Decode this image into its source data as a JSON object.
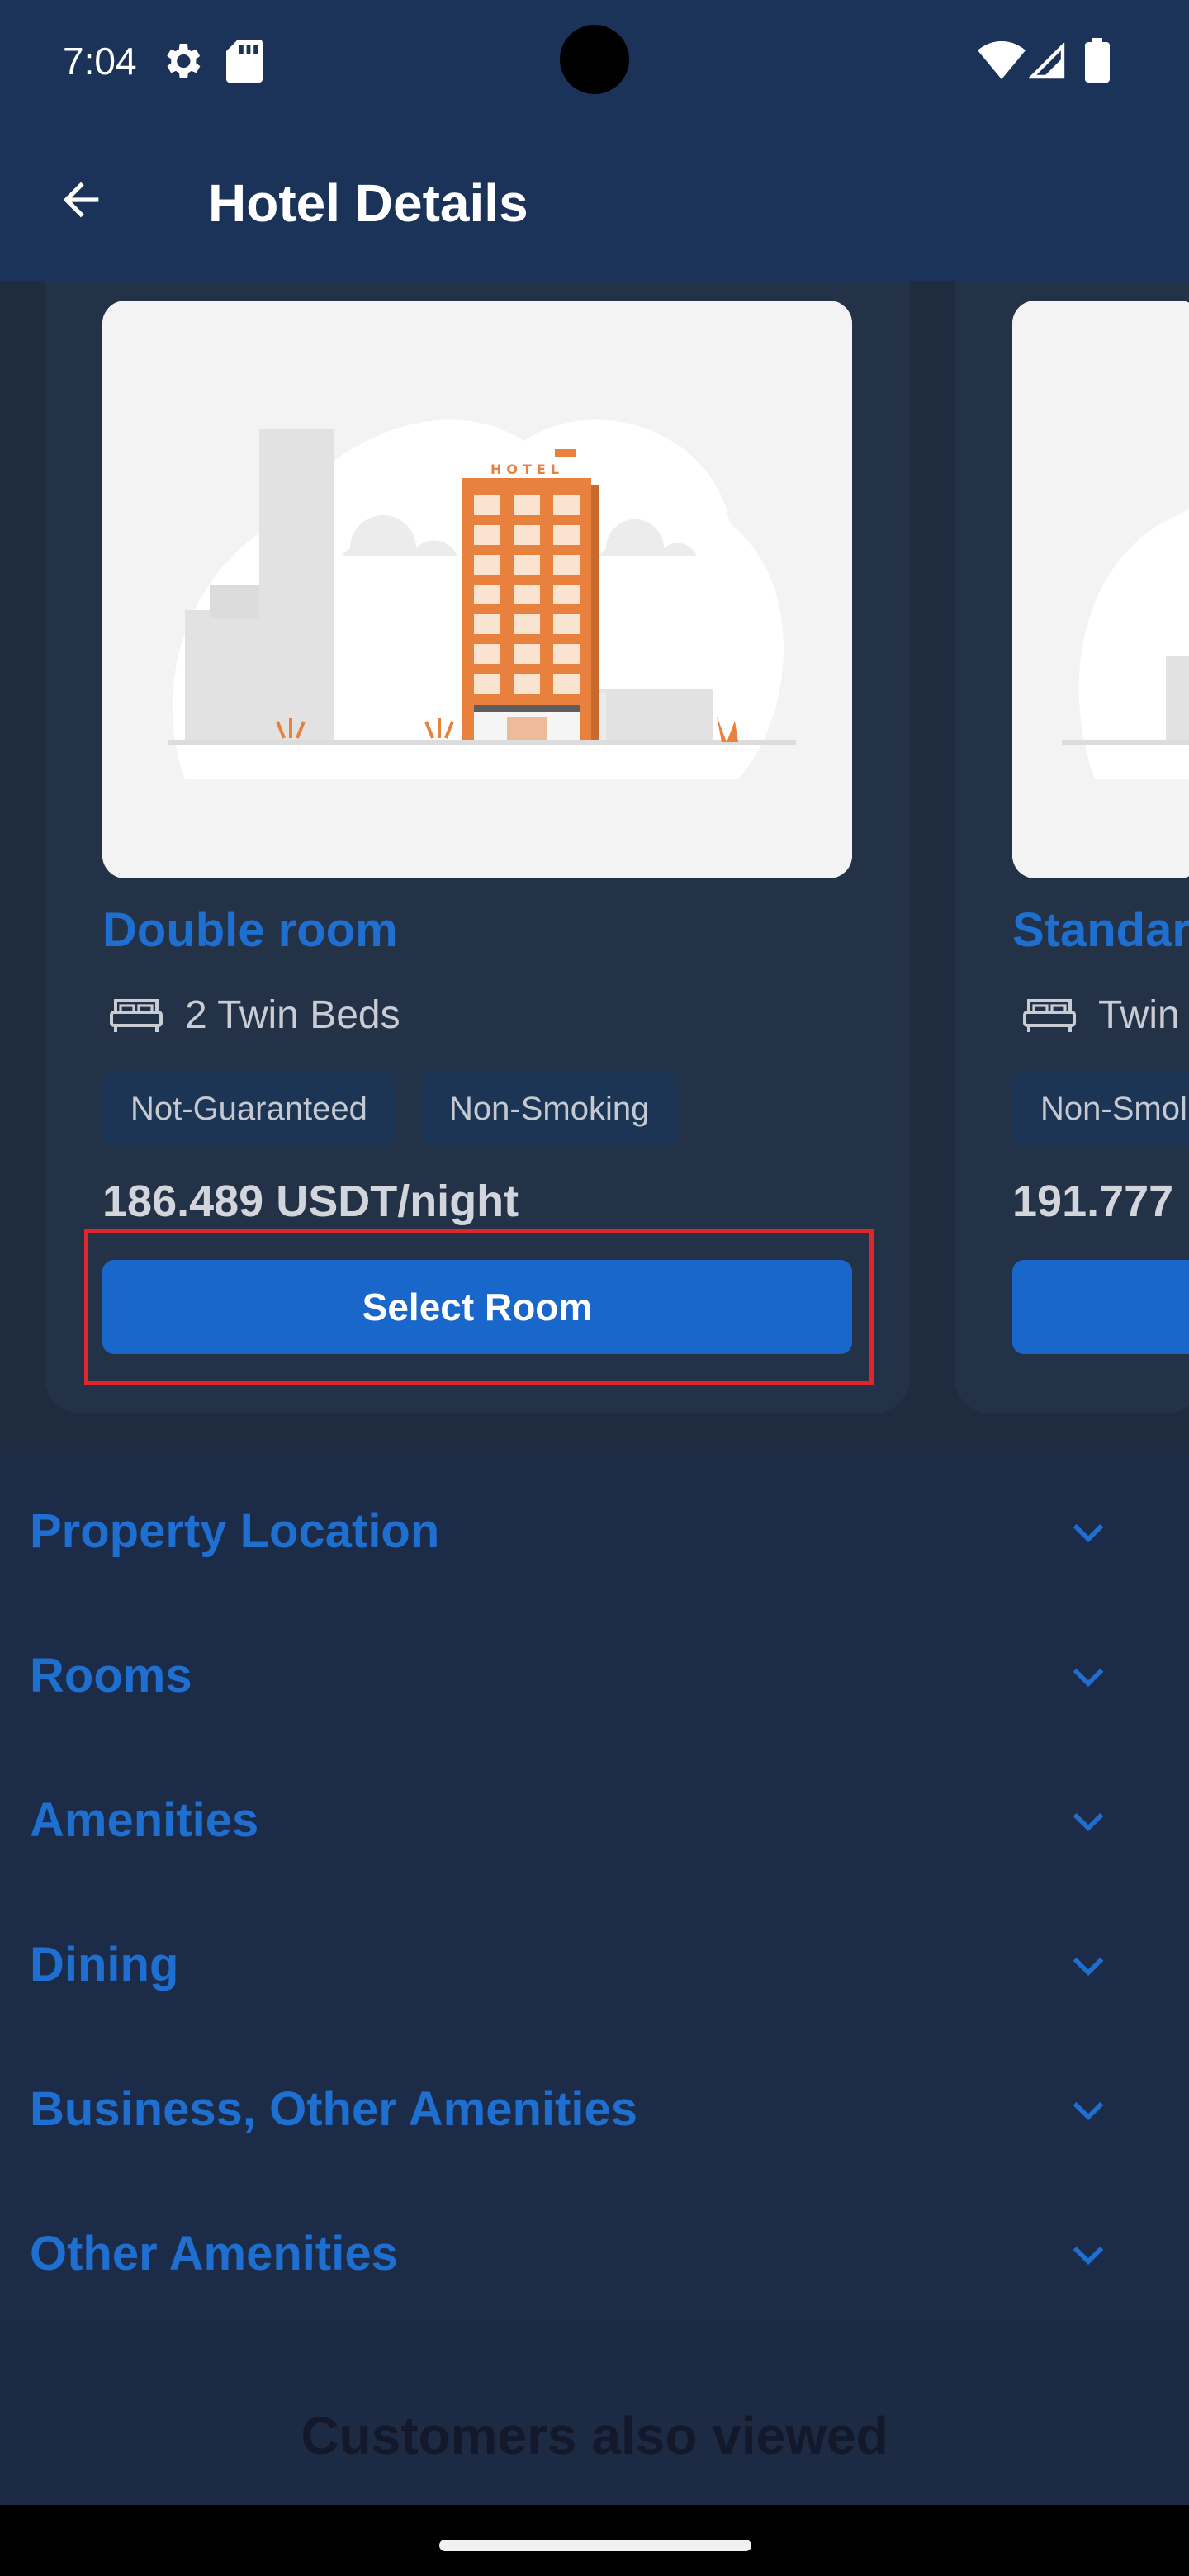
{
  "status_bar": {
    "time": "7:04"
  },
  "app_bar": {
    "title": "Hotel Details"
  },
  "rooms": [
    {
      "name": "Double room",
      "beds": "2 Twin Beds",
      "tags": [
        "Not-Guaranteed",
        "Non-Smoking"
      ],
      "price": "186.489 USDT/night",
      "button": "Select Room"
    },
    {
      "name": "Standar",
      "beds": "Twin",
      "tags": [
        "Non-Smol"
      ],
      "price": "191.777"
    }
  ],
  "hotel_sign": "HOTEL",
  "sections": [
    {
      "label": "Property Location"
    },
    {
      "label": "Rooms"
    },
    {
      "label": "Amenities"
    },
    {
      "label": "Dining"
    },
    {
      "label": "Business, Other Amenities"
    },
    {
      "label": "Other Amenities"
    }
  ],
  "customers_title": "Customers also viewed",
  "colors": {
    "accent": "#1e6fd0",
    "button": "#1a67cc",
    "app_bar": "#1b3358",
    "highlight": "#e0262b",
    "building": "#e8803e"
  }
}
